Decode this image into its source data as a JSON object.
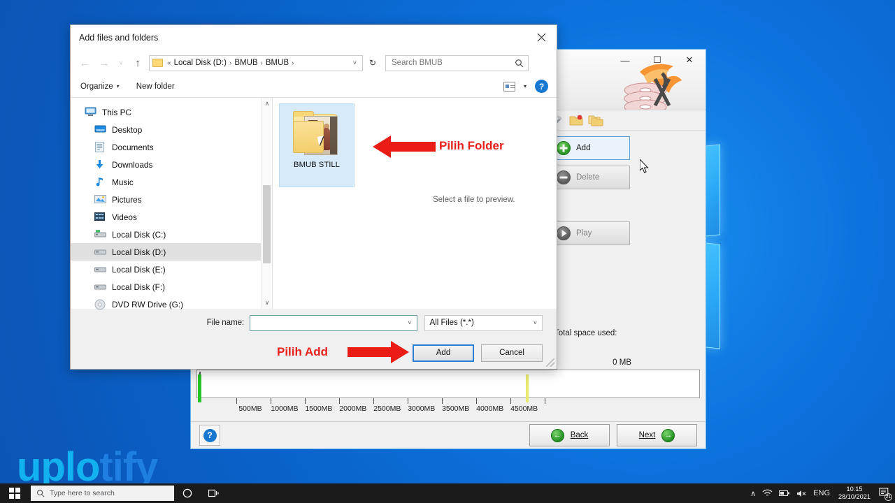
{
  "desktop": {
    "background_color": "#0b6ed5"
  },
  "watermark": {
    "part1": "uplo",
    "part2": "tify"
  },
  "taskbar": {
    "start_icon": "windows-logo-icon",
    "search_placeholder": "Type here to search",
    "cortana_icon": "cortana-circle-icon",
    "taskview_icon": "task-view-icon",
    "tray": {
      "chevron": "∧",
      "network_icon": "wifi-icon",
      "battery_icon": "battery-icon",
      "volume_icon": "speaker-muted-icon",
      "language": "ENG",
      "time": "10:15",
      "date": "28/10/2021",
      "notification_icon": "notification-icon",
      "notification_count": "21"
    }
  },
  "dialog": {
    "title": "Add files and folders",
    "close_icon": "close-icon",
    "nav": {
      "back_icon": "←",
      "forward_icon": "→",
      "history_icon": "˅",
      "up_icon": "↑",
      "folder_icon": "folder-icon",
      "breadcrumb_prefix": "«",
      "breadcrumb": [
        "Local Disk (D:)",
        "BMUB",
        "BMUB"
      ],
      "separator": "›",
      "dropdown_icon": "˅",
      "refresh_icon": "↻"
    },
    "search": {
      "placeholder": "Search BMUB",
      "icon": "search-icon"
    },
    "toolbar": {
      "organize_label": "Organize",
      "organize_chevron": "▾",
      "new_folder_label": "New folder",
      "view_icon": "view-layout-icon",
      "view_chevron": "▾",
      "help_icon": "help-icon",
      "help_glyph": "?"
    },
    "tree": [
      {
        "label": "This PC",
        "icon": "monitor-icon",
        "level": 0,
        "selected": false
      },
      {
        "label": "Desktop",
        "icon": "desktop-icon",
        "level": 1,
        "selected": false
      },
      {
        "label": "Documents",
        "icon": "documents-icon",
        "level": 1,
        "selected": false
      },
      {
        "label": "Downloads",
        "icon": "downloads-icon",
        "level": 1,
        "selected": false
      },
      {
        "label": "Music",
        "icon": "music-icon",
        "level": 1,
        "selected": false
      },
      {
        "label": "Pictures",
        "icon": "pictures-icon",
        "level": 1,
        "selected": false
      },
      {
        "label": "Videos",
        "icon": "videos-icon",
        "level": 1,
        "selected": false
      },
      {
        "label": "Local Disk (C:)",
        "icon": "system-drive-icon",
        "level": 1,
        "selected": false
      },
      {
        "label": "Local Disk (D:)",
        "icon": "drive-icon",
        "level": 1,
        "selected": true
      },
      {
        "label": "Local Disk (E:)",
        "icon": "drive-icon",
        "level": 1,
        "selected": false
      },
      {
        "label": "Local Disk (F:)",
        "icon": "drive-icon",
        "level": 1,
        "selected": false
      },
      {
        "label": "DVD RW Drive (G:)",
        "icon": "dvd-drive-icon",
        "level": 1,
        "selected": false
      }
    ],
    "scroll": {
      "up_arrow": "∧",
      "down_arrow": "∨"
    },
    "content": {
      "folder_label": "BMUB STILL",
      "folder_icon": "folder-thumbnail-icon",
      "preview_text": "Select a file to preview."
    },
    "filename": {
      "label": "File name:",
      "value": "",
      "placeholder": "",
      "dropdown_icon": "˅"
    },
    "filter": {
      "value": "All Files (*.*)",
      "dropdown_icon": "˅"
    },
    "buttons": {
      "add": "Add",
      "cancel": "Cancel"
    }
  },
  "annotations": {
    "folder_note": "Pilih Folder",
    "add_note": "Pilih Add",
    "arrow_color": "#ea1c16",
    "text_color": "#e8201b"
  },
  "burner": {
    "window_controls": {
      "minimize": "—",
      "maximize": "☐",
      "close": "✕"
    },
    "logo_icon": "burning-disc-icon",
    "toolbar_icons": [
      "hammer-icon",
      "new-folder-icon",
      "copy-folder-icon"
    ],
    "actions": [
      {
        "label": "Add",
        "icon": "add-circle-icon",
        "enabled": true,
        "accent": "#2a9a26"
      },
      {
        "label": "Delete",
        "icon": "delete-circle-icon",
        "enabled": false,
        "accent": "#5f5f5f"
      },
      {
        "label": "Play",
        "icon": "play-circle-icon",
        "enabled": false,
        "accent": "#5f5f5f"
      }
    ],
    "space": {
      "label": "Total space used:",
      "value": "0 MB",
      "ruler_ticks": [
        "500MB",
        "1000MB",
        "1500MB",
        "2000MB",
        "2500MB",
        "3000MB",
        "3500MB",
        "4000MB",
        "4500MB"
      ],
      "used_marker_color": "#27c427",
      "capacity_marker_color": "#e9e96b"
    },
    "footer": {
      "help_icon": "help-icon",
      "help_glyph": "?",
      "back_label": "Back",
      "back_icon": "←",
      "next_label": "Next",
      "next_icon": "→"
    }
  }
}
